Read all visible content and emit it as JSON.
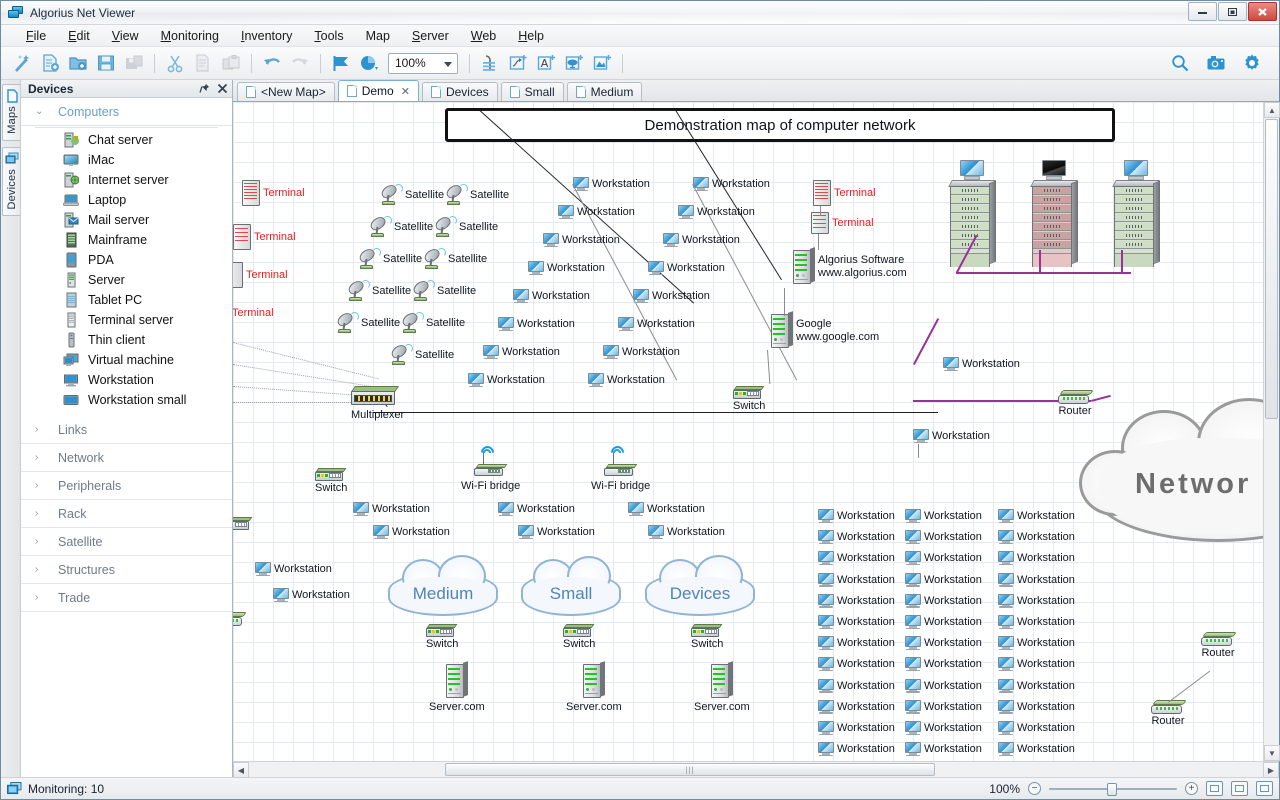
{
  "window": {
    "title": "Algorius Net Viewer",
    "app_icon": "network-monitor-icon",
    "minimize": "—",
    "maximize": "❐",
    "close": "✕"
  },
  "menu": [
    {
      "label": "File",
      "accel": "F"
    },
    {
      "label": "Edit",
      "accel": "E"
    },
    {
      "label": "View",
      "accel": "V"
    },
    {
      "label": "Monitoring",
      "accel": "M"
    },
    {
      "label": "Inventory",
      "accel": "I"
    },
    {
      "label": "Tools",
      "accel": "T"
    },
    {
      "label": "Map",
      "accel": ""
    },
    {
      "label": "Server",
      "accel": "S"
    },
    {
      "label": "Web",
      "accel": "W"
    },
    {
      "label": "Help",
      "accel": "H"
    }
  ],
  "toolbar": {
    "zoom_value": "100%",
    "buttons": [
      {
        "name": "new-map-wizard-icon",
        "title": "New map wizard",
        "disabled": false
      },
      {
        "name": "new-document-icon",
        "title": "New document",
        "disabled": false
      },
      {
        "name": "open-folder-icon",
        "title": "Open",
        "disabled": false
      },
      {
        "name": "save-icon",
        "title": "Save",
        "disabled": false
      },
      {
        "name": "save-all-icon",
        "title": "Save all",
        "disabled": true
      },
      {
        "name": "cut-icon",
        "title": "Cut",
        "disabled": true
      },
      {
        "name": "copy-icon",
        "title": "Copy",
        "disabled": true
      },
      {
        "name": "paste-icon",
        "title": "Paste",
        "disabled": true
      },
      {
        "name": "undo-icon",
        "title": "Undo",
        "disabled": false
      },
      {
        "name": "redo-icon",
        "title": "Redo",
        "disabled": true
      },
      {
        "name": "monitoring-flag-icon",
        "title": "Monitoring",
        "disabled": false
      },
      {
        "name": "report-chart-icon",
        "title": "Reports",
        "disabled": false
      },
      {
        "name": "align-icon",
        "title": "Align",
        "disabled": false
      },
      {
        "name": "add-link-icon",
        "title": "Add link",
        "disabled": false
      },
      {
        "name": "add-text-icon",
        "title": "Add text",
        "disabled": false
      },
      {
        "name": "add-cloud-icon",
        "title": "Add cloud",
        "disabled": false
      },
      {
        "name": "add-image-icon",
        "title": "Add image",
        "disabled": false
      }
    ],
    "right_buttons": [
      {
        "name": "search-icon",
        "title": "Search"
      },
      {
        "name": "camera-icon",
        "title": "Screenshot"
      },
      {
        "name": "gear-icon",
        "title": "Settings"
      }
    ]
  },
  "rail_tabs": [
    {
      "label": "Maps",
      "icon": "page-icon"
    },
    {
      "label": "Devices",
      "icon": "devices-icon"
    }
  ],
  "panel": {
    "title": "Devices",
    "pin_icon": "pin-icon",
    "close_icon": "close-icon",
    "groups": [
      {
        "label": "Computers",
        "expanded": true,
        "items": [
          {
            "label": "Chat server",
            "icon": "chat-server-icon"
          },
          {
            "label": "iMac",
            "icon": "imac-icon"
          },
          {
            "label": "Internet server",
            "icon": "internet-server-icon"
          },
          {
            "label": "Laptop",
            "icon": "laptop-icon"
          },
          {
            "label": "Mail server",
            "icon": "mail-server-icon"
          },
          {
            "label": "Mainframe",
            "icon": "mainframe-icon"
          },
          {
            "label": "PDA",
            "icon": "pda-icon"
          },
          {
            "label": "Server",
            "icon": "server-icon"
          },
          {
            "label": "Tablet PC",
            "icon": "tablet-pc-icon"
          },
          {
            "label": "Terminal server",
            "icon": "terminal-server-icon"
          },
          {
            "label": "Thin client",
            "icon": "thin-client-icon"
          },
          {
            "label": "Virtual machine",
            "icon": "virtual-machine-icon"
          },
          {
            "label": "Workstation",
            "icon": "workstation-icon"
          },
          {
            "label": "Workstation small",
            "icon": "workstation-small-icon"
          }
        ]
      },
      {
        "label": "Links",
        "expanded": false,
        "items": []
      },
      {
        "label": "Network",
        "expanded": false,
        "items": []
      },
      {
        "label": "Peripherals",
        "expanded": false,
        "items": []
      },
      {
        "label": "Rack",
        "expanded": false,
        "items": []
      },
      {
        "label": "Satellite",
        "expanded": false,
        "items": []
      },
      {
        "label": "Structures",
        "expanded": false,
        "items": []
      },
      {
        "label": "Trade",
        "expanded": false,
        "items": []
      }
    ]
  },
  "tabs": [
    {
      "label": "<New Map>",
      "active": false,
      "closable": false
    },
    {
      "label": "Demo",
      "active": true,
      "closable": true
    },
    {
      "label": "Devices",
      "active": false,
      "closable": false
    },
    {
      "label": "Small",
      "active": false,
      "closable": false
    },
    {
      "label": "Medium",
      "active": false,
      "closable": false
    }
  ],
  "map": {
    "banner_title": "Demonstration map of computer network",
    "labels": {
      "workstation": "Workstation",
      "terminal": "Terminal",
      "satellite": "Satellite",
      "switch": "Switch",
      "router": "Router",
      "multiplexer": "Multiplexer",
      "wifi_bridge": "Wi-Fi bridge",
      "server_com": "Server.com"
    },
    "servers": [
      {
        "name": "Algorius Software",
        "url": "www.algorius.com"
      },
      {
        "name": "Google",
        "url": "www.google.com"
      }
    ],
    "clouds": [
      {
        "label": "Medium"
      },
      {
        "label": "Small"
      },
      {
        "label": "Devices"
      }
    ],
    "big_cloud": "Networ",
    "colors": {
      "link_purple": "#9b2f9b",
      "terminal_red": "#e02020",
      "cloud_blue_text": "#4e84b8",
      "grid": "#e4eaf0"
    }
  },
  "statusbar": {
    "monitoring_label": "Monitoring: 10",
    "monitoring_icon": "monitor-icon",
    "zoom_percent": "100%",
    "zoom_out": "⊖",
    "zoom_in": "⊕",
    "fit_buttons": [
      "fit-page-icon",
      "fit-width-icon",
      "fit-screen-icon"
    ]
  }
}
